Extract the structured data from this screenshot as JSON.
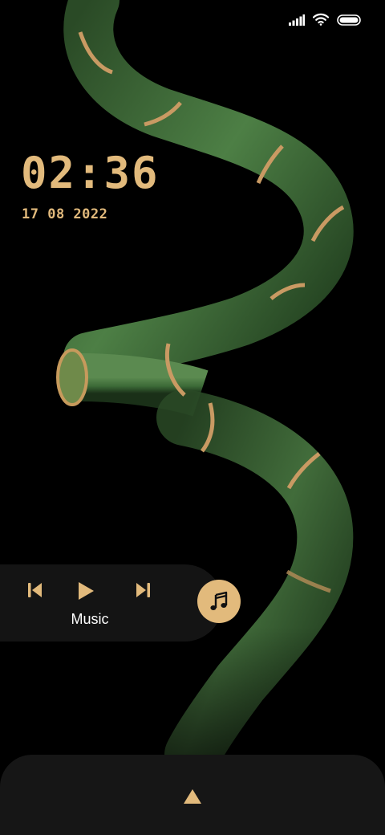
{
  "lockscreen": {
    "time": "02:36",
    "date": "17 08 2022"
  },
  "music": {
    "label": "Music"
  },
  "icons": {
    "status": [
      "signal-icon",
      "wifi-icon",
      "battery-icon"
    ],
    "player": [
      "previous-icon",
      "play-icon",
      "next-icon",
      "music-note-icon"
    ],
    "unlock": "up-arrow-icon"
  },
  "colors": {
    "accent": "#e2ba7c",
    "background": "#000000",
    "panel": "#161616",
    "bamboo": "#3f6b3a"
  }
}
